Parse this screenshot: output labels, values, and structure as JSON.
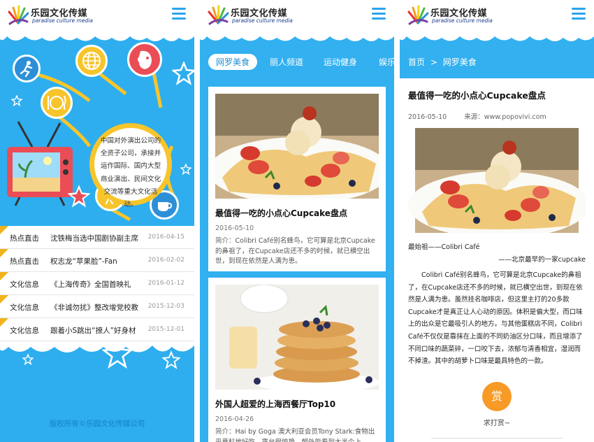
{
  "brand": {
    "name": "乐园文化传媒",
    "subtitle": "paradise culture media"
  },
  "home": {
    "intro": "中国对外演出公司的全资子公司，承接并运作国际、国内大型商业演出、民间文化交流等重大文化活动。",
    "news": [
      {
        "category": "热点直击",
        "title": "沈铁梅当选中国剧协副主席",
        "date": "2016-04-15"
      },
      {
        "category": "热点直击",
        "title": "权志龙“苹果脸”-Fan",
        "date": "2016-02-02"
      },
      {
        "category": "文化信息",
        "title": "《上海传奇》全国首映礼",
        "date": "2016-01-12"
      },
      {
        "category": "文化信息",
        "title": "《非诚勿扰》整改增党校教",
        "date": "2015-12-03"
      },
      {
        "category": "文化信息",
        "title": "跟着小S跳出“撩人”好身材",
        "date": "2015-12-01"
      }
    ],
    "footer": "版权所有©乐园文化传媒公司"
  },
  "list": {
    "tabs": [
      "网罗美食",
      "丽人频道",
      "运动健身",
      "娱乐"
    ],
    "articles": [
      {
        "title": "最值得一吃的小点心Cupcake盘点",
        "date": "2016-05-10",
        "summary_label": "简介：",
        "summary": "Colibri Café别名蜂鸟，它可算是北京Cupcake的鼻祖了，在Cupcake店还不多的时候，就已横空出世，到现在依然是人满为患。"
      },
      {
        "title": "外国人超爱的上海西餐厅Top10",
        "date": "2016-04-26",
        "summary_label": "简介：",
        "summary": "Hai by Goga  澳大利亚会员Tony Stark:食物出乎意料地好吃，露台很惊艳，朝外能看到大半个上"
      }
    ]
  },
  "detail": {
    "breadcrumb": [
      "首页",
      ">",
      "网罗美食"
    ],
    "title": "最值得一吃的小点心Cupcake盘点",
    "date": "2016-05-10",
    "source": "来源：www.popovivi.com",
    "caption": "最始祖——Colibri Café",
    "caption2": "——北京最早的一家cupcake",
    "body": "Colibri Café别名蜂鸟，它可算是北京Cupcake的鼻祖了，在Cupcake店还不多的时候，就已横空出世，到现在依然是人满为患。虽然挂名咖啡店，但这里主打的20多款Cupcake才是真正让人心动的原因。体积是偏大型，而口味上的出众是它最吸引人的地方。与其他蛋糕店不同，Colibri Café不仅仅是靠抹在上面的不同奶油区分口味，而且增添了不同口味的蔬菜碎，一口咬下去，浓郁与清香相宜，湿润而不掉渣。其中的胡萝卜口味是最具特色的一款。",
    "reward_button": "赏",
    "reward_label": "求打赏~"
  },
  "colors": {
    "sky": "#2eaeee",
    "accent_yellow": "#f7c52b",
    "ribbon": "#f0b31b",
    "reward": "#f89a26",
    "link_blue": "#1c8fd6"
  },
  "icons": [
    "logo-icon",
    "menu-icon",
    "skate-icon",
    "globe-icon",
    "opera-mask-icon",
    "dining-icon",
    "golf-icon",
    "coffee-icon",
    "tv-icon",
    "star-icon"
  ]
}
